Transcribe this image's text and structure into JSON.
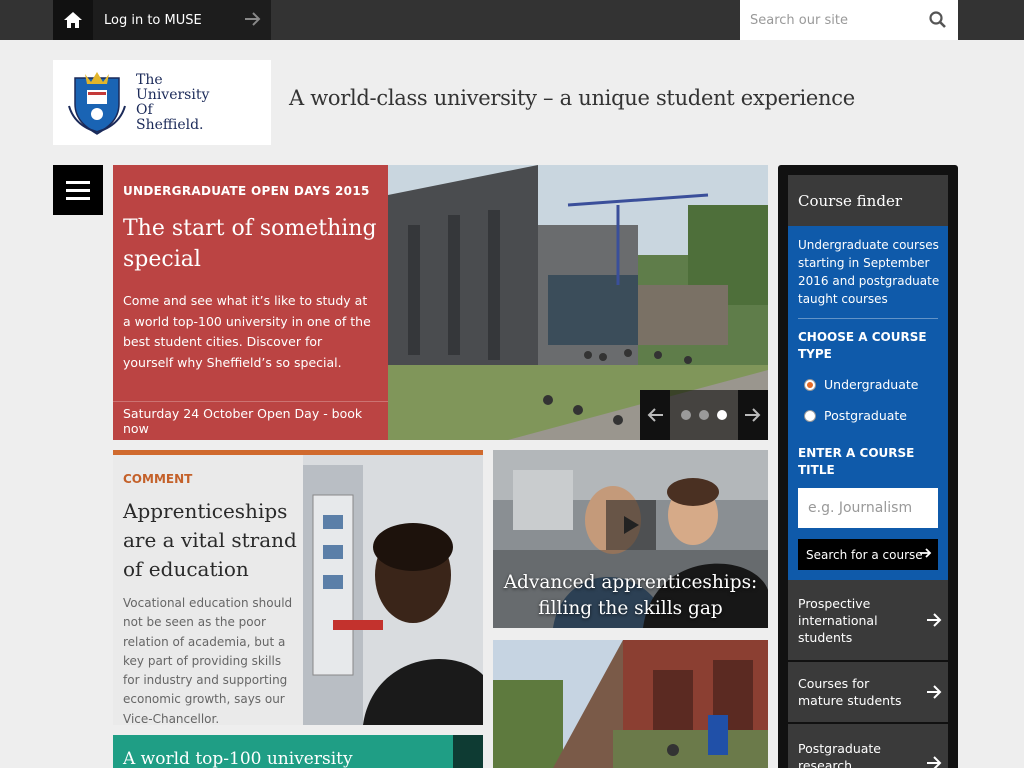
{
  "topbar": {
    "login_label": "Log in to MUSE",
    "search_placeholder": "Search our site"
  },
  "header": {
    "logo_lines": [
      "The",
      "University",
      "Of",
      "Sheffield."
    ],
    "tagline": "A world-class university – a unique student experience"
  },
  "hero": {
    "kicker": "UNDERGRADUATE OPEN DAYS 2015",
    "title": "The start of something special",
    "body": "Come and see what it’s like to study at a world top-100 university in one of the best student cities. Discover for yourself why Sheffield’s so special.",
    "link": "Saturday 24 October Open Day - book now",
    "slides": 3,
    "active_slide": 3
  },
  "comment": {
    "kicker": "COMMENT",
    "title": "Apprenticeships are a vital strand of education",
    "body": "Vocational education should not be seen as the poor relation of academia, but a key part of providing skills for industry and supporting economic growth, says our Vice-Chancellor."
  },
  "video": {
    "title": "Advanced apprenticeships: filling the skills gap"
  },
  "green_card": {
    "title": "A world top-100 university"
  },
  "course_finder": {
    "heading": "Course finder",
    "description": "Undergraduate courses starting in September 2016 and postgraduate taught courses",
    "type_heading": "CHOOSE A COURSE TYPE",
    "types": [
      "Undergraduate",
      "Postgraduate"
    ],
    "selected_type": "Undergraduate",
    "title_heading": "ENTER A COURSE TITLE",
    "title_placeholder": "e.g. Journalism",
    "search_button": "Search for a course",
    "links": [
      "Prospective international students",
      "Courses for mature students",
      "Postgraduate research"
    ]
  },
  "colors": {
    "hero_panel": "#c43a3a",
    "comment_accent": "#d06a2e",
    "finder_blue": "#0f5aaa",
    "green_card": "#1f9e85"
  }
}
